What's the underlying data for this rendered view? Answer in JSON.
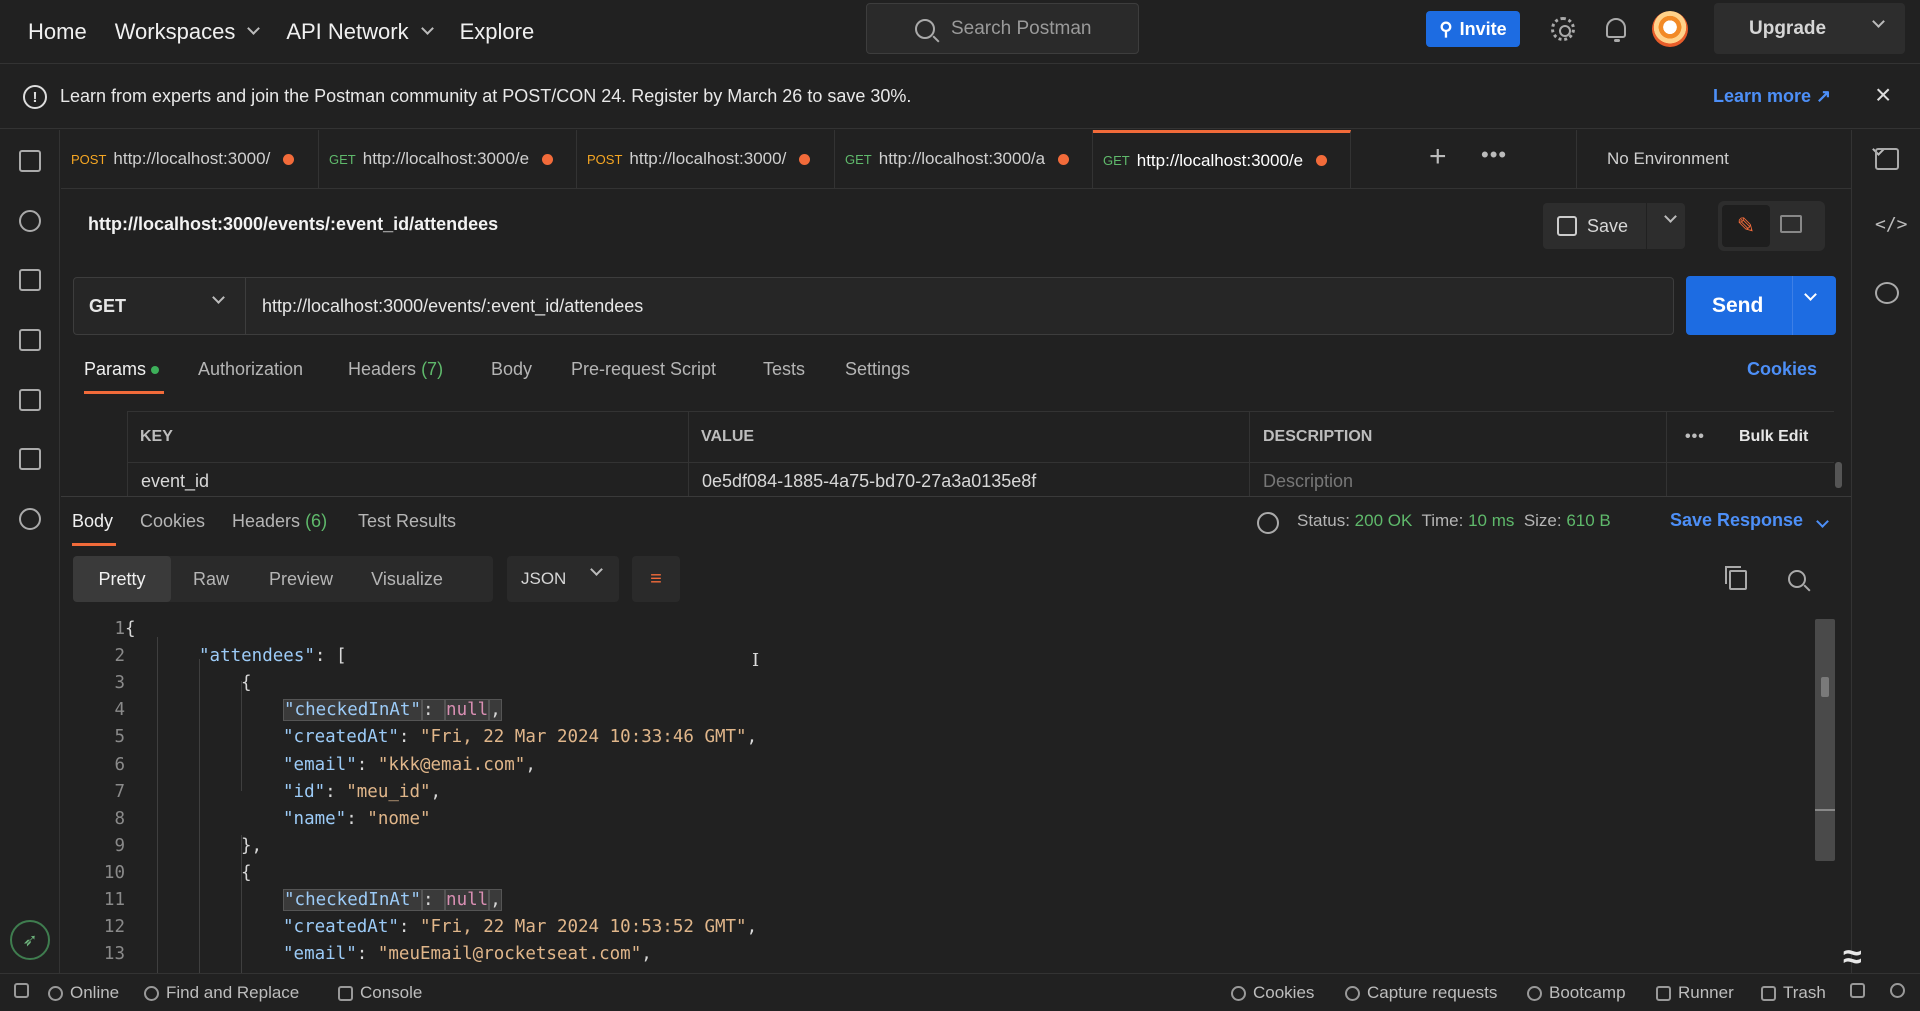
{
  "topnav": {
    "home": "Home",
    "workspaces": "Workspaces",
    "api_network": "API Network",
    "explore": "Explore",
    "search_placeholder": "Search Postman",
    "invite": "Invite",
    "upgrade": "Upgrade"
  },
  "banner": {
    "text": "Learn from experts and join the Postman community at POST/CON 24. Register by March 26 to save 30%.",
    "learn_more": "Learn more ↗",
    "close": "×"
  },
  "tabs": [
    {
      "method": "POST",
      "label": "http://localhost:3000/",
      "unsaved": true
    },
    {
      "method": "GET",
      "label": "http://localhost:3000/e",
      "unsaved": true
    },
    {
      "method": "POST",
      "label": "http://localhost:3000/",
      "unsaved": true
    },
    {
      "method": "GET",
      "label": "http://localhost:3000/a",
      "unsaved": true
    },
    {
      "method": "GET",
      "label": "http://localhost:3000/e",
      "unsaved": true,
      "active": true
    }
  ],
  "environment": "No Environment",
  "request": {
    "title": "http://localhost:3000/events/:event_id/attendees",
    "save": "Save",
    "method": "GET",
    "url": "http://localhost:3000/events/:event_id/attendees",
    "send": "Send"
  },
  "request_tabs": {
    "params": "Params",
    "authorization": "Authorization",
    "headers": "Headers",
    "headers_count": "(7)",
    "body": "Body",
    "prerequest": "Pre-request Script",
    "tests": "Tests",
    "settings": "Settings",
    "cookies": "Cookies"
  },
  "params_table": {
    "key_header": "KEY",
    "value_header": "VALUE",
    "description_header": "DESCRIPTION",
    "more": "•••",
    "bulk_edit": "Bulk Edit",
    "row": {
      "key": "event_id",
      "value": "0e5df084-1885-4a75-bd70-27a3a0135e8f",
      "description_placeholder": "Description"
    }
  },
  "response": {
    "tab_body": "Body",
    "tab_cookies": "Cookies",
    "tab_headers": "Headers",
    "headers_count": "(6)",
    "tab_test_results": "Test Results",
    "status_label": "Status:",
    "status_value": "200 OK",
    "time_label": "Time:",
    "time_value": "10 ms",
    "size_label": "Size:",
    "size_value": "610 B",
    "save_response": "Save Response",
    "views": {
      "pretty": "Pretty",
      "raw": "Raw",
      "preview": "Preview",
      "visualize": "Visualize"
    },
    "format": "JSON"
  },
  "code_lines": [
    {
      "n": "1",
      "indent": 0,
      "text": "{"
    },
    {
      "n": "2",
      "indent": 1,
      "key": "\"attendees\"",
      "rest": ": ["
    },
    {
      "n": "3",
      "indent": 2,
      "text": "{"
    },
    {
      "n": "4",
      "indent": 3,
      "key": "\"checkedInAt\"",
      "sep": ": ",
      "null": "null",
      "rest": ",",
      "hl": true
    },
    {
      "n": "5",
      "indent": 3,
      "key": "\"createdAt\"",
      "sep": ": ",
      "str": "\"Fri, 22 Mar 2024 10:33:46 GMT\"",
      "rest": ","
    },
    {
      "n": "6",
      "indent": 3,
      "key": "\"email\"",
      "sep": ": ",
      "str": "\"kkk@emai.com\"",
      "rest": ","
    },
    {
      "n": "7",
      "indent": 3,
      "key": "\"id\"",
      "sep": ": ",
      "str": "\"meu_id\"",
      "rest": ","
    },
    {
      "n": "8",
      "indent": 3,
      "key": "\"name\"",
      "sep": ": ",
      "str": "\"nome\"",
      "rest": ""
    },
    {
      "n": "9",
      "indent": 2,
      "text": "},"
    },
    {
      "n": "10",
      "indent": 2,
      "text": "{"
    },
    {
      "n": "11",
      "indent": 3,
      "key": "\"checkedInAt\"",
      "sep": ": ",
      "null": "null",
      "rest": ",",
      "hl": true
    },
    {
      "n": "12",
      "indent": 3,
      "key": "\"createdAt\"",
      "sep": ": ",
      "str": "\"Fri, 22 Mar 2024 10:53:52 GMT\"",
      "rest": ","
    },
    {
      "n": "13",
      "indent": 3,
      "key": "\"email\"",
      "sep": ": ",
      "str": "\"meuEmail@rocketseat.com\"",
      "rest": ","
    }
  ],
  "statusbar": {
    "online": "Online",
    "find_replace": "Find and Replace",
    "console": "Console",
    "cookies": "Cookies",
    "capture": "Capture requests",
    "bootcamp": "Bootcamp",
    "runner": "Runner",
    "trash": "Trash"
  },
  "colors": {
    "accent": "#f26b3a",
    "primary": "#1d6ce2",
    "success": "#5fb96b",
    "post": "#f5a623"
  }
}
